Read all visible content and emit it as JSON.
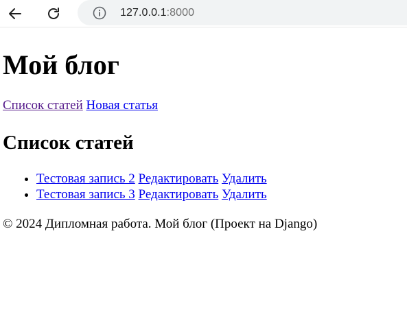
{
  "browser": {
    "url_host": "127.0.0.1",
    "url_port": ":8000",
    "icons": [
      "back-arrow-icon",
      "reload-icon",
      "info-icon"
    ]
  },
  "page": {
    "title": "Мой блог",
    "nav": {
      "articles_link": "Список статей",
      "new_article_link": "Новая статья"
    },
    "section_title": "Список статей",
    "articles": [
      {
        "title": "Тестовая запись 2",
        "edit": "Редактировать",
        "delete": "Удалить"
      },
      {
        "title": "Тестовая запись 3",
        "edit": "Редактировать",
        "delete": "Удалить"
      }
    ],
    "footer": "© 2024 Дипломная работа. Мой блог (Проект на Django)"
  },
  "colors": {
    "link": "#0000ee",
    "visited_link": "#551a8b",
    "omnibox_bg": "#f1f3f4"
  }
}
